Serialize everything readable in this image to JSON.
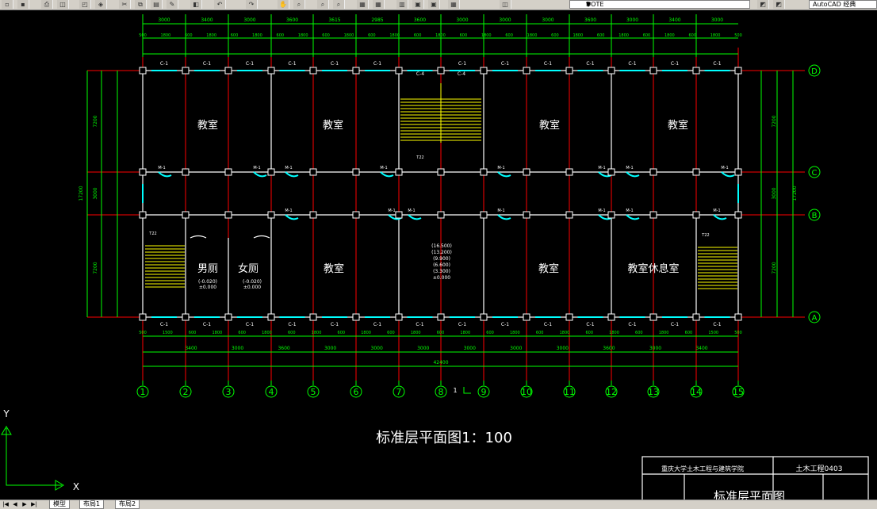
{
  "toolbar": {
    "layer_name": "DOTE",
    "workspace": "AutoCAD 经典"
  },
  "drawing": {
    "title": "标准层平面图1：100",
    "total_dim": "42400",
    "grid_cols": [
      "1",
      "2",
      "3",
      "4",
      "5",
      "6",
      "7",
      "8",
      "9",
      "10",
      "11",
      "12",
      "13",
      "14",
      "15"
    ],
    "grid_rows": [
      "D",
      "C",
      "B",
      "A"
    ],
    "top_dims": [
      "3000",
      "3400",
      "3000",
      "3600",
      "3615",
      "2985",
      "3600",
      "3000",
      "3000",
      "3000",
      "3600",
      "3000",
      "3400",
      "3000"
    ],
    "bottom_dims": [
      "3400",
      "3000",
      "3600",
      "3000",
      "3000",
      "3000",
      "3000",
      "3000",
      "3000",
      "3600",
      "3000",
      "3400"
    ],
    "top_window_dims": [
      "500",
      "1800",
      "600",
      "1800",
      "600",
      "1800",
      "600",
      "1800",
      "600",
      "1800",
      "600",
      "1800",
      "600",
      "1800",
      "600",
      "1800",
      "600",
      "1800",
      "600",
      "1800",
      "600",
      "1800",
      "600",
      "1800",
      "600",
      "1800",
      "500"
    ],
    "bottom_window_dims": [
      "500",
      "1500",
      "600",
      "1800",
      "600",
      "1800",
      "600",
      "1800",
      "600",
      "1800",
      "600",
      "1800",
      "600",
      "1800",
      "600",
      "1800",
      "600",
      "1800",
      "600",
      "1800",
      "600",
      "1800",
      "600",
      "1500",
      "500"
    ],
    "side_dims_left": [
      "7200",
      "3000",
      "7200"
    ],
    "side_dims_outer": "17200",
    "rooms": [
      "教室",
      "教室",
      "教室",
      "教室",
      "男厕",
      "女厕",
      "教室",
      "教室",
      "教室休息室"
    ],
    "window_tag": "C-1",
    "door_tag": "M-1",
    "stair_tag": "C-4",
    "stair_label_top": "T22",
    "elevation_marks": [
      "(16.500)",
      "(13.200)",
      "(9.900)",
      "(6.600)",
      "(3.300)",
      "±0.000"
    ],
    "toilet_levels": [
      "(-0.020)",
      "±0.000"
    ],
    "section_mark": "1",
    "axis_y": "Y",
    "axis_x": "X"
  },
  "title_block": {
    "school": "重庆大学土木工程与建筑学院",
    "class_code": "土木工程0403",
    "drawing_name": "标准层平面图"
  },
  "layout_tabs": [
    "模型",
    "布局1",
    "布局2"
  ],
  "colors": {
    "wall": "#ffffff",
    "axis": "#ff0000",
    "dimension": "#00ff00",
    "window": "#00ffff",
    "stair": "#ffff00",
    "background": "#000000"
  }
}
